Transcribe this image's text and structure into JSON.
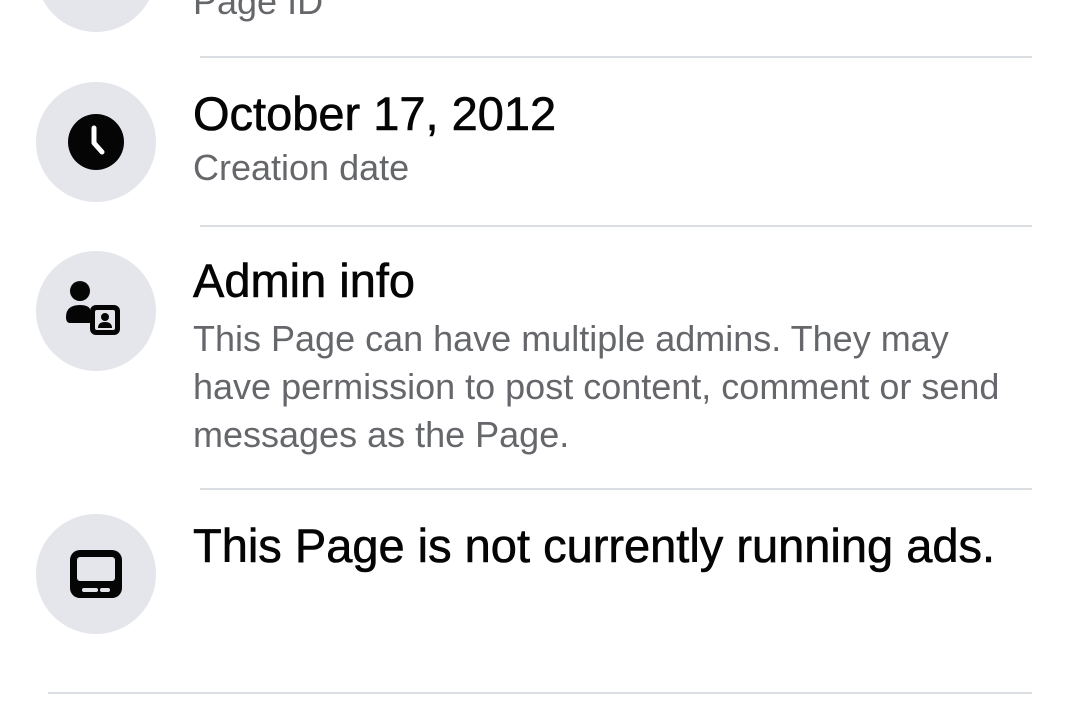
{
  "rows": {
    "page_id": {
      "subtitle": "Page ID"
    },
    "creation": {
      "title": "October 17, 2012",
      "subtitle": "Creation date",
      "icon": "clock-icon"
    },
    "admin": {
      "title": "Admin info",
      "subtitle": "This Page can have multiple admins. They may have permission to post content, comment or send messages as the Page.",
      "icon": "admin-badge-icon"
    },
    "ads": {
      "title": "This Page is not currently running ads.",
      "icon": "ads-monitor-icon"
    }
  },
  "colors": {
    "icon_circle_bg": "#e4e6eb",
    "primary_text": "#050505",
    "secondary_text": "#65676b",
    "divider": "#dadde1"
  }
}
